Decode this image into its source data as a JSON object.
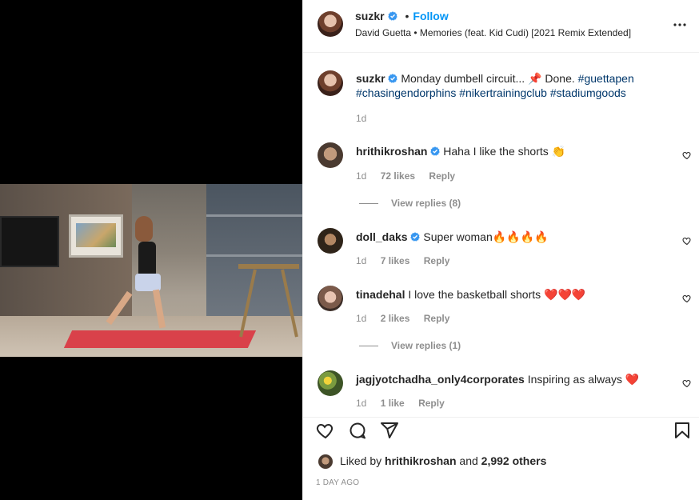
{
  "colors": {
    "accent": "#0095f6",
    "verified": "#3897f0",
    "hashtag": "#00376b",
    "muted": "#8e8e8e",
    "heart_emoji": "#ed1c24"
  },
  "post": {
    "username": "suzkr",
    "follow_label": "Follow",
    "dot": "•",
    "audio": "David Guetta • Memories (feat. Kid Cudi) [2021 Remix Extended]",
    "caption": {
      "username": "suzkr",
      "text": "Monday dumbell circuit... 📌 Done.",
      "hashtags": [
        "#guettapen",
        "#chasingendorphins",
        "#nikertrainingclub",
        "#stadiumgoods"
      ],
      "time": "1d"
    }
  },
  "comments": [
    {
      "username": "hrithikroshan",
      "verified": true,
      "text": "Haha I like the shorts 👏",
      "time": "1d",
      "likes": "72 likes",
      "reply": "Reply",
      "view_replies": "View replies (8)"
    },
    {
      "username": "doll_daks",
      "verified": true,
      "text": "Super woman🔥🔥🔥🔥",
      "time": "1d",
      "likes": "7 likes",
      "reply": "Reply",
      "view_replies": ""
    },
    {
      "username": "tinadehal",
      "verified": false,
      "text": "I love the basketball shorts ❤️❤️❤️",
      "time": "1d",
      "likes": "2 likes",
      "reply": "Reply",
      "view_replies": "View replies (1)"
    },
    {
      "username": "jagjyotchadha_only4corporates",
      "verified": false,
      "text": "Inspiring as always ❤️",
      "time": "1d",
      "likes": "1 like",
      "reply": "Reply",
      "view_replies": ""
    }
  ],
  "actions": {
    "like_icon": "heart-icon",
    "comment_icon": "comment-bubble-icon",
    "share_icon": "paper-plane-icon",
    "save_icon": "bookmark-icon",
    "liked_by_prefix": "Liked by",
    "liked_by_user": "hrithikroshan",
    "liked_by_and": "and",
    "liked_by_others": "2,992 others",
    "time_ago": "1 DAY AGO"
  }
}
